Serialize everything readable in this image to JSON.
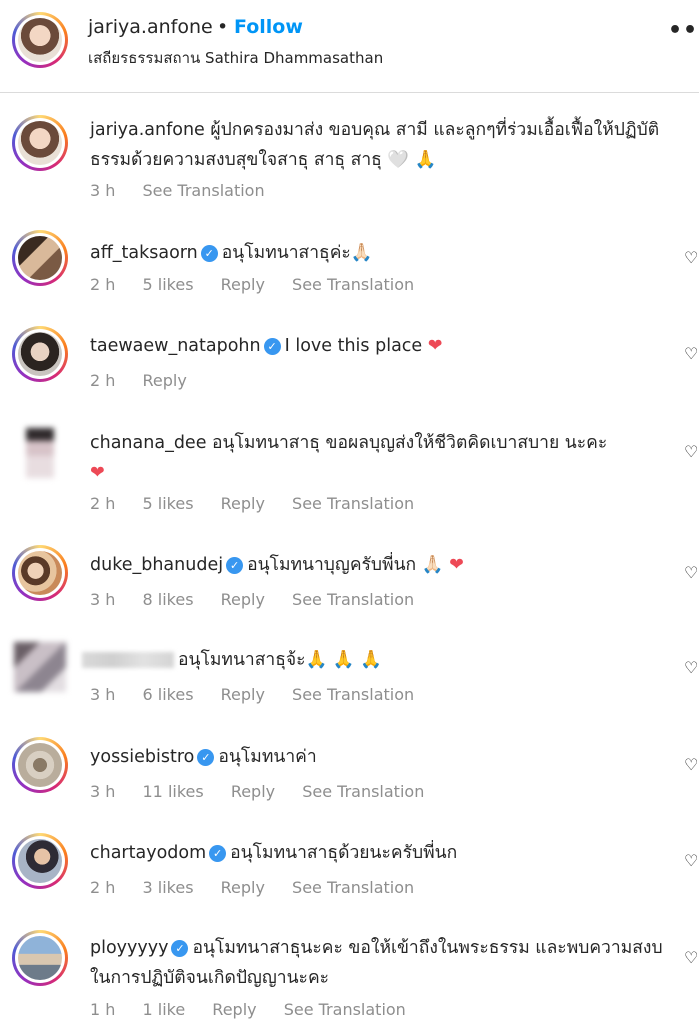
{
  "header": {
    "username": "jariya.anfone",
    "dot": "•",
    "follow_label": "Follow",
    "location": "เสถียรธรรมสถาน Sathira Dhammasathan",
    "more_icon": "•••"
  },
  "labels": {
    "reply": "Reply",
    "see_translation": "See Translation",
    "verified_check": "✓",
    "heart_outline": "♡"
  },
  "comments": [
    {
      "username": "jariya.anfone",
      "text": "ผู้ปกครองมาส่ง ขอบคุณ สามี และลูกๆที่ร่วมเอื้อเฟื้อให้ปฏิบัติธรรมด้วยความสงบสุขใจสาธุ สาธุ สาธุ 🤍 🙏",
      "time": "3 h"
    },
    {
      "username": "aff_taksaorn",
      "text": "อนุโมทนาสาธุค่ะ🙏🏻",
      "time": "2 h",
      "likes": "5 likes"
    },
    {
      "username": "taewaew_natapohn",
      "text": "I love this place",
      "emoji": "❤",
      "time": "2 h"
    },
    {
      "username": "chanana_dee",
      "text": "อนุโมทนาสาธุ ขอผลบุญส่งให้ชีวิตคิดเบาสบาย นะคะ",
      "emoji": "❤",
      "time": "2 h",
      "likes": "5 likes"
    },
    {
      "username": "duke_bhanudej",
      "text": "อนุโมทนาบุญครับพี่นก 🙏🏻",
      "emoji": "❤",
      "time": "3 h",
      "likes": "8 likes"
    },
    {
      "username": "",
      "text": "อนุโมทนาสาธุจ้ะ🙏 🙏 🙏",
      "time": "3 h",
      "likes": "6 likes"
    },
    {
      "username": "yossiebistro",
      "text": "อนุโมทนาค่า",
      "time": "3 h",
      "likes": "11 likes"
    },
    {
      "username": "chartayodom",
      "text": "อนุโมทนาสาธุด้วยนะครับพี่นก",
      "time": "2 h",
      "likes": "3 likes"
    },
    {
      "username": "ployyyyy",
      "text": "อนุโมทนาสาธุนะคะ ขอให้เข้าถึงในพระธรรม และพบความสงบในการปฏิบัติจนเกิดปัญญานะคะ",
      "time": "1 h",
      "likes": "1 like"
    }
  ],
  "colors": {
    "accent_blue": "#0095f6",
    "verified_blue": "#3897f0",
    "heart_red": "#ed4956",
    "meta_gray": "#8e8e8e"
  }
}
